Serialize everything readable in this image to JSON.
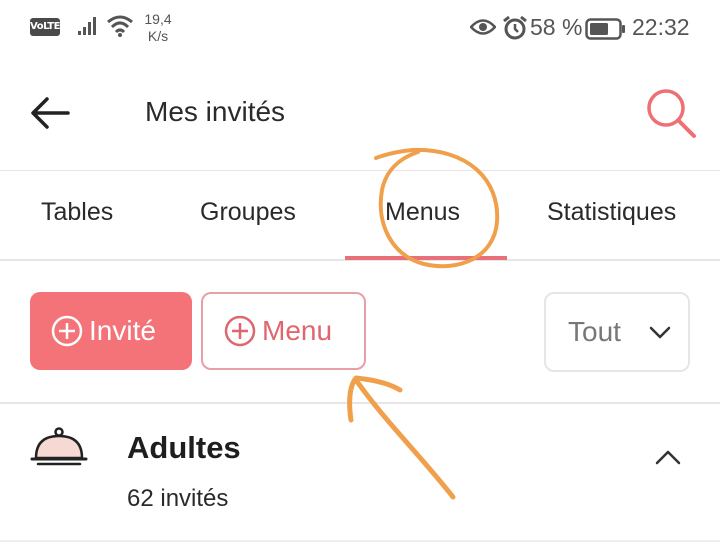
{
  "status_bar": {
    "network_badge": "VoLTE",
    "net_speed_value": "19,4",
    "net_speed_unit": "K/s",
    "battery_percent": "58 %",
    "time": "22:32"
  },
  "app_bar": {
    "title": "Mes invités"
  },
  "tabs": [
    {
      "label": "Tables"
    },
    {
      "label": "Groupes"
    },
    {
      "label": "Menus",
      "active": true
    },
    {
      "label": "Statistiques"
    }
  ],
  "actions": {
    "add_guest_label": "Invité",
    "add_menu_label": "Menu",
    "filter_value": "Tout"
  },
  "section": {
    "title": "Adultes",
    "count": "62 invités",
    "icon": "cloche-icon"
  },
  "colors": {
    "accent": "#f37378",
    "annotation": "#f0a04b"
  }
}
